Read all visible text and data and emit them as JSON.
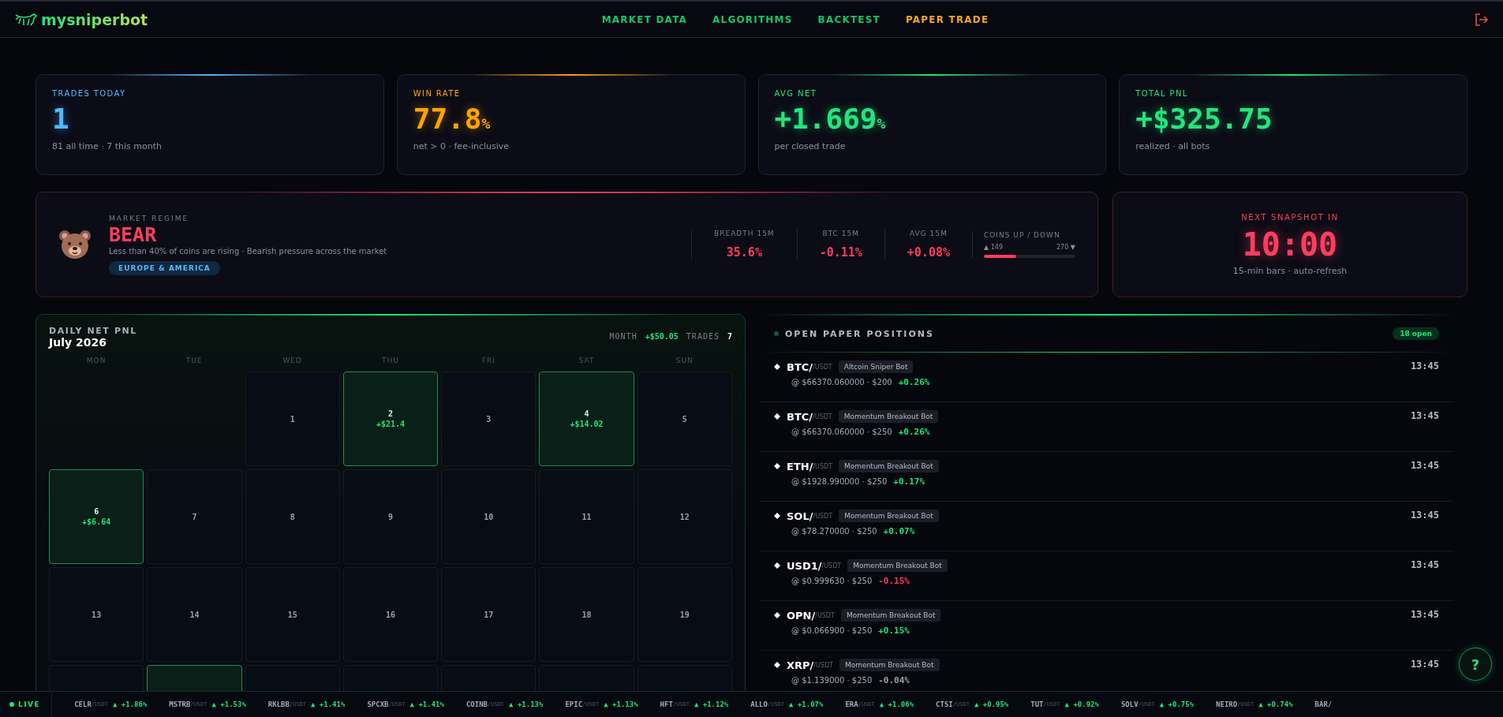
{
  "brand": "mysniperbot",
  "nav": [
    {
      "label": "MARKET DATA",
      "selected": false
    },
    {
      "label": "ALGORITHMS",
      "selected": false
    },
    {
      "label": "BACKTEST",
      "selected": false
    },
    {
      "label": "PAPER TRADE",
      "selected": true
    }
  ],
  "stats": [
    {
      "label": "TRADES TODAY",
      "value": "1",
      "note": "81 all time · 7 this month",
      "color": "#4fb8ff"
    },
    {
      "label": "WIN RATE",
      "value": "77.8",
      "unit": "%",
      "note": "net > 0 · fee-inclusive",
      "color": "#ffa500"
    },
    {
      "label": "AVG NET",
      "value": "+1.669",
      "unit": "%",
      "note": "per closed trade",
      "color": "#22e67d"
    },
    {
      "label": "TOTAL PNL",
      "value": "+$325.75",
      "note": "realized · all bots",
      "color": "#22e67d"
    }
  ],
  "regime": {
    "label": "MARKET REGIME",
    "name": "BEAR",
    "description": "Less than 40% of coins are rising · Bearish pressure across the market",
    "session": "EUROPE & AMERICA",
    "metrics": [
      {
        "label": "BREADTH 15M",
        "value": "35.6%"
      },
      {
        "label": "BTC 15M",
        "value": "-0.11%"
      },
      {
        "label": "AVG 15M",
        "value": "+0.08%"
      }
    ],
    "coins": {
      "label": "COINS UP / DOWN",
      "up": "▲ 149",
      "down": "270 ▼",
      "level": 0.356
    }
  },
  "snapshot": {
    "label": "NEXT SNAPSHOT IN",
    "time": "10:00",
    "note": "15-min bars · auto-refresh"
  },
  "calendar": {
    "title": "DAILY NET PNL",
    "month": "July 2026",
    "month_label": "MONTH",
    "month_value": "+$50.05",
    "trades_label": "TRADES",
    "trades_value": "7",
    "weekdays": [
      "MON",
      "TUE",
      "WED",
      "THU",
      "FRI",
      "SAT",
      "SUN"
    ],
    "weeks": [
      [
        {
          "kind": "blank"
        },
        {
          "kind": "blank"
        },
        {
          "kind": "day",
          "day": "1",
          "positive": false
        },
        {
          "kind": "day",
          "day": "2",
          "pnl": "+$21.4",
          "positive": true
        },
        {
          "kind": "day",
          "day": "3",
          "positive": false
        },
        {
          "kind": "day",
          "day": "4",
          "pnl": "+$14.02",
          "positive": true
        },
        {
          "kind": "day",
          "day": "5",
          "positive": false
        }
      ],
      [
        {
          "kind": "day",
          "day": "6",
          "pnl": "+$6.64",
          "positive": true
        },
        {
          "kind": "day",
          "day": "7",
          "positive": false
        },
        {
          "kind": "day",
          "day": "8",
          "positive": false
        },
        {
          "kind": "day",
          "day": "9",
          "positive": false
        },
        {
          "kind": "day",
          "day": "10",
          "positive": false
        },
        {
          "kind": "day",
          "day": "11",
          "positive": false
        },
        {
          "kind": "day",
          "day": "12",
          "positive": false
        }
      ],
      [
        {
          "kind": "day",
          "day": "13",
          "positive": false
        },
        {
          "kind": "day",
          "day": "14",
          "positive": false
        },
        {
          "kind": "day",
          "day": "15",
          "positive": false
        },
        {
          "kind": "day",
          "day": "16",
          "positive": false
        },
        {
          "kind": "day",
          "day": "17",
          "positive": false
        },
        {
          "kind": "day",
          "day": "18",
          "positive": false
        },
        {
          "kind": "day",
          "day": "19",
          "positive": false
        }
      ],
      [
        {
          "kind": "day",
          "positive": false
        },
        {
          "kind": "day",
          "positive": true
        },
        {
          "kind": "day",
          "positive": false
        },
        {
          "kind": "day",
          "positive": false
        },
        {
          "kind": "day",
          "positive": false
        },
        {
          "kind": "day",
          "positive": false
        },
        {
          "kind": "day",
          "positive": false
        }
      ]
    ]
  },
  "positions": {
    "title": "OPEN PAPER POSITIONS",
    "count": "18 open",
    "items": [
      {
        "base": "BTC/",
        "quote": "/USDT",
        "bot": "Altcoin Sniper Bot",
        "detail": "@ $66370.060000 · $200",
        "change": "+0.26%",
        "color": "#1fe57a",
        "time": "13:45"
      },
      {
        "base": "BTC/",
        "quote": "/USDT",
        "bot": "Momentum Breakout Bot",
        "detail": "@ $66370.060000 · $250",
        "change": "+0.26%",
        "color": "#1fe57a",
        "time": "13:45"
      },
      {
        "base": "ETH/",
        "quote": "/USDT",
        "bot": "Momentum Breakout Bot",
        "detail": "@ $1928.990000 · $250",
        "change": "+0.17%",
        "color": "#1fe57a",
        "time": "13:45"
      },
      {
        "base": "SOL/",
        "quote": "/USDT",
        "bot": "Momentum Breakout Bot",
        "detail": "@ $78.270000 · $250",
        "change": "+0.07%",
        "color": "#1fe57a",
        "time": "13:45"
      },
      {
        "base": "USD1/",
        "quote": "/USDT",
        "bot": "Momentum Breakout Bot",
        "detail": "@ $0.999630 · $250",
        "change": "-0.15%",
        "color": "#ff3d5e",
        "time": "13:45"
      },
      {
        "base": "OPN/",
        "quote": "/USDT",
        "bot": "Momentum Breakout Bot",
        "detail": "@ $0.066900 · $250",
        "change": "+0.15%",
        "color": "#1fe57a",
        "time": "13:45"
      },
      {
        "base": "XRP/",
        "quote": "/USDT",
        "bot": "Momentum Breakout Bot",
        "detail": "@ $1.139000 · $250",
        "change": "-0.04%",
        "color": "#9aa0ae",
        "time": "13:45"
      }
    ]
  },
  "help": "?",
  "ticker": {
    "live": "LIVE",
    "items": [
      {
        "symbol": "CELR",
        "quote": "/USDT",
        "change": "▲ +1.86%"
      },
      {
        "symbol": "MSTRB",
        "quote": "/USDT",
        "change": "▲ +1.53%"
      },
      {
        "symbol": "RKLBB",
        "quote": "/USDT",
        "change": "▲ +1.41%"
      },
      {
        "symbol": "SPCXB",
        "quote": "/USDT",
        "change": "▲ +1.41%"
      },
      {
        "symbol": "COINB",
        "quote": "/USDT",
        "change": "▲ +1.13%"
      },
      {
        "symbol": "EPIC",
        "quote": "/USDT",
        "change": "▲ +1.13%"
      },
      {
        "symbol": "HFT",
        "quote": "/USDT",
        "change": "▲ +1.12%"
      },
      {
        "symbol": "ALLO",
        "quote": "/USDT",
        "change": "▲ +1.07%"
      },
      {
        "symbol": "ERA",
        "quote": "/USDT",
        "change": "▲ +1.06%"
      },
      {
        "symbol": "CTSI",
        "quote": "/USDT",
        "change": "▲ +0.95%"
      },
      {
        "symbol": "TUT",
        "quote": "/USDT",
        "change": "▲ +0.92%"
      },
      {
        "symbol": "SOLV",
        "quote": "/USDT",
        "change": "▲ +0.75%"
      },
      {
        "symbol": "NEIRO",
        "quote": "/USDT",
        "change": "▲ +0.74%"
      },
      {
        "symbol": "BAR/"
      }
    ]
  }
}
